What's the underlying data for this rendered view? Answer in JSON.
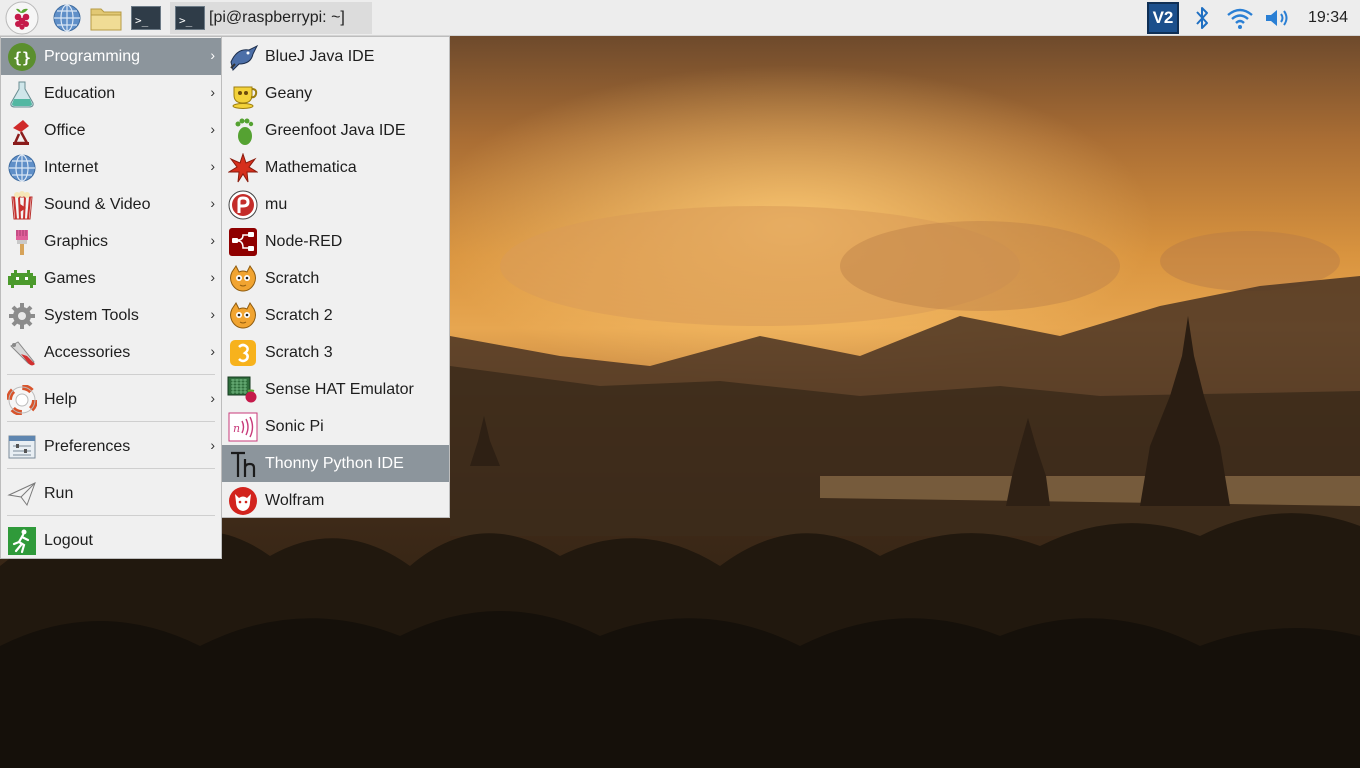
{
  "taskbar": {
    "window_title": "[pi@raspberrypi: ~]",
    "clock": "19:34",
    "terminal_glyph": ">_",
    "vnc_label": "V2"
  },
  "main_menu": {
    "items": [
      {
        "label": "Programming",
        "icon": "programming-icon"
      },
      {
        "label": "Education",
        "icon": "education-icon"
      },
      {
        "label": "Office",
        "icon": "office-icon"
      },
      {
        "label": "Internet",
        "icon": "internet-icon"
      },
      {
        "label": "Sound & Video",
        "icon": "sound-video-icon"
      },
      {
        "label": "Graphics",
        "icon": "graphics-icon"
      },
      {
        "label": "Games",
        "icon": "games-icon"
      },
      {
        "label": "System Tools",
        "icon": "system-tools-icon"
      },
      {
        "label": "Accessories",
        "icon": "accessories-icon"
      },
      {
        "label": "Help",
        "icon": "help-icon"
      },
      {
        "label": "Preferences",
        "icon": "preferences-icon"
      },
      {
        "label": "Run",
        "icon": "run-icon"
      },
      {
        "label": "Logout",
        "icon": "logout-icon"
      }
    ],
    "active": "Programming",
    "submenu_arrow": "›"
  },
  "programming_menu": {
    "items": [
      {
        "label": "BlueJ Java IDE",
        "icon": "bluej-icon"
      },
      {
        "label": "Geany",
        "icon": "geany-icon"
      },
      {
        "label": "Greenfoot Java IDE",
        "icon": "greenfoot-icon"
      },
      {
        "label": "Mathematica",
        "icon": "mathematica-icon"
      },
      {
        "label": "mu",
        "icon": "mu-icon"
      },
      {
        "label": "Node-RED",
        "icon": "node-red-icon"
      },
      {
        "label": "Scratch",
        "icon": "scratch-icon"
      },
      {
        "label": "Scratch 2",
        "icon": "scratch2-icon"
      },
      {
        "label": "Scratch 3",
        "icon": "scratch3-icon"
      },
      {
        "label": "Sense HAT Emulator",
        "icon": "sense-hat-icon"
      },
      {
        "label": "Sonic Pi",
        "icon": "sonic-pi-icon"
      },
      {
        "label": "Thonny Python IDE",
        "icon": "thonny-icon"
      },
      {
        "label": "Wolfram",
        "icon": "wolfram-icon"
      }
    ],
    "active": "Thonny Python IDE"
  },
  "colors": {
    "menu_bg": "#f0f0f0",
    "highlight": "#8c959c",
    "panel_bg": "#ededed"
  }
}
